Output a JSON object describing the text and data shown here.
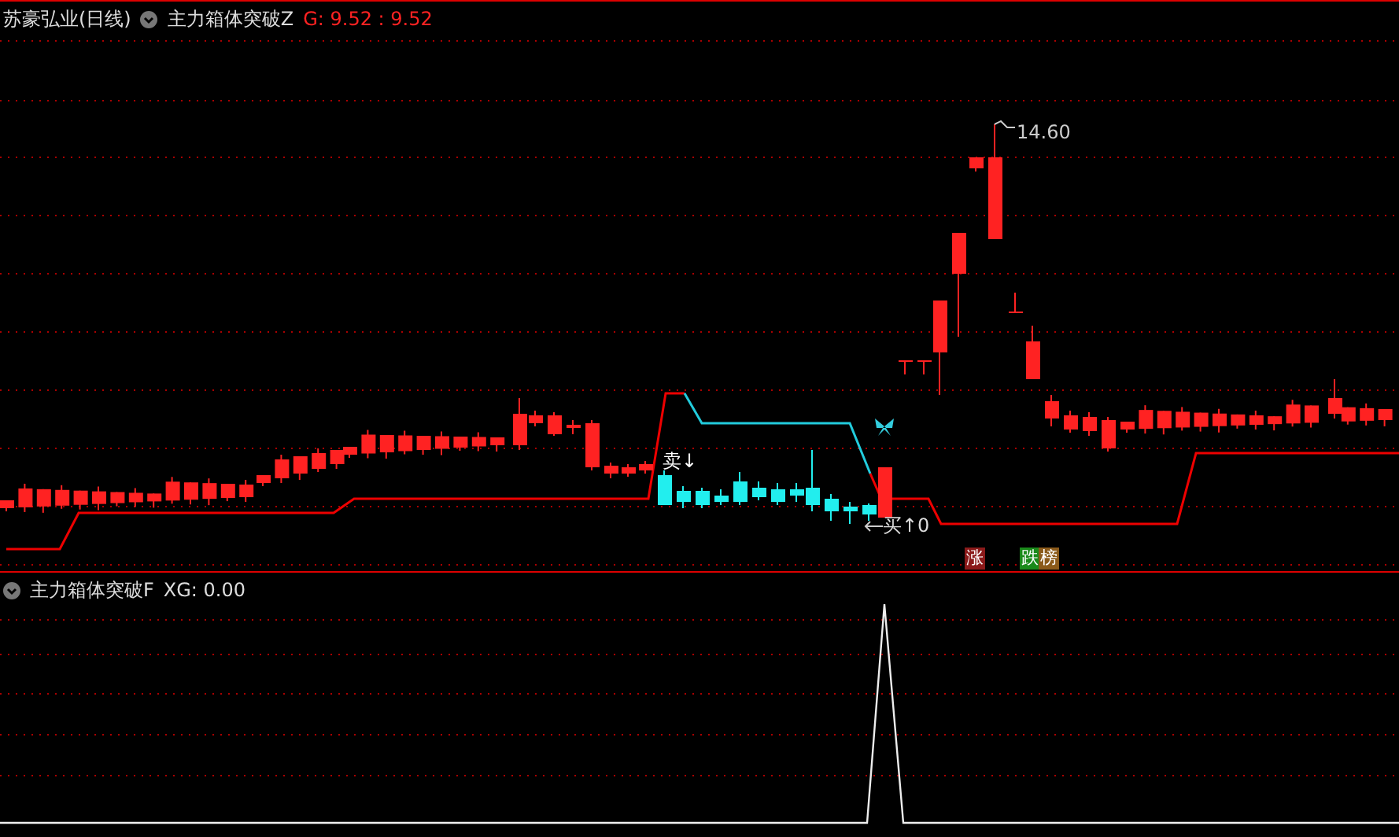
{
  "stock": {
    "name": "苏豪弘业(日线)"
  },
  "main_indicator": {
    "name": "主力箱体突破Z",
    "reading": "G: 9.52 : 9.52"
  },
  "chart_labels": {
    "peak": "14.60",
    "sell": "卖↓",
    "buy": "买↑0"
  },
  "badges": [
    {
      "text": "涨",
      "color": "#8b1a1a"
    },
    {
      "text": "跌",
      "color": "#1a8a1a"
    },
    {
      "text": "榜",
      "color": "#8b5a1a"
    }
  ],
  "sub_indicator": {
    "name": "主力箱体突破F",
    "reading": "XG: 0.00"
  }
}
